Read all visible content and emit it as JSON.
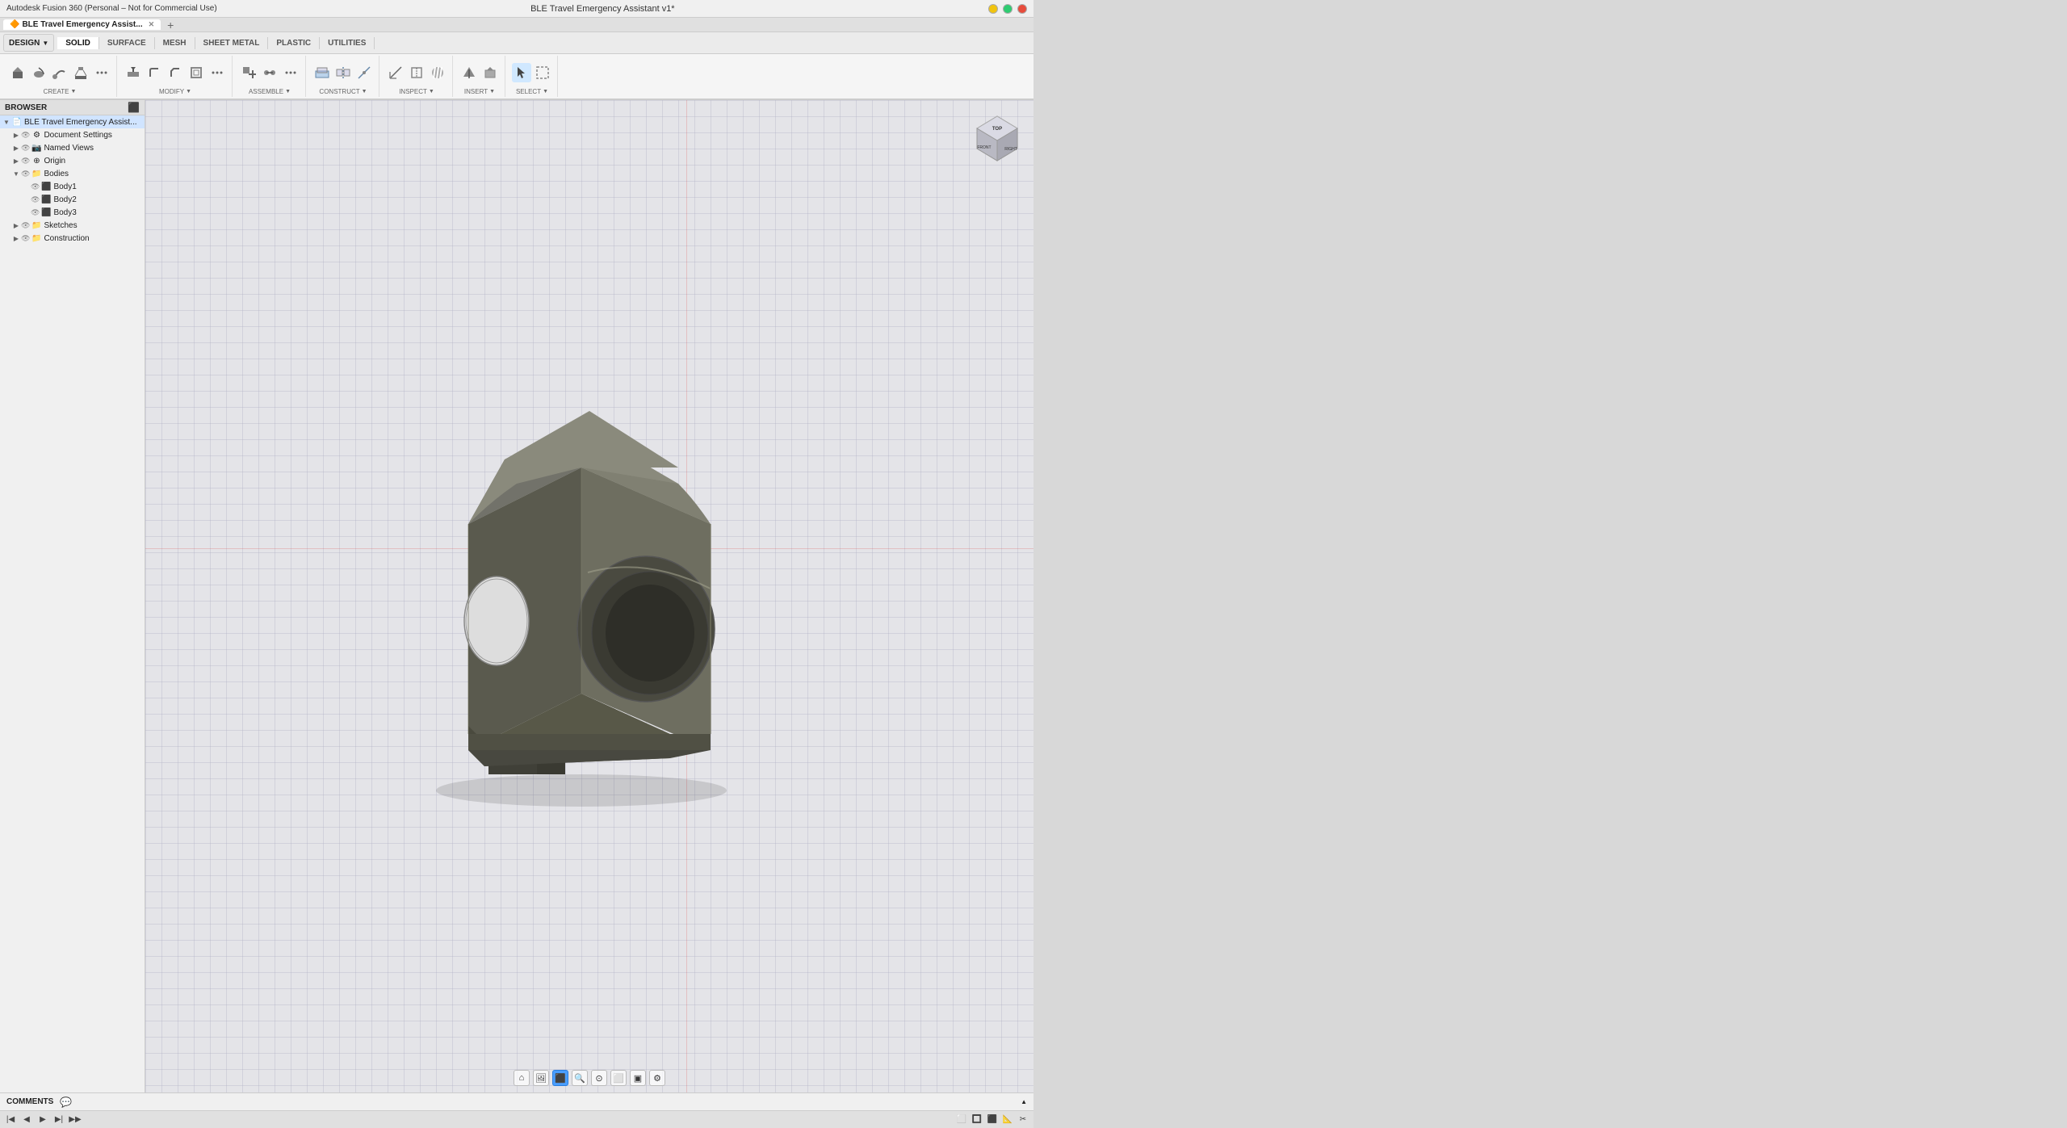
{
  "app": {
    "title": "Autodesk Fusion 360 (Personal – Not for Commercial Use)",
    "window_title": "BLE Travel Emergency Assistant v1*"
  },
  "tabs": [
    {
      "label": "BLE Travel Emergency Assist...",
      "active": true,
      "icon": "🔶"
    }
  ],
  "workspace_tabs": [
    {
      "label": "SOLID",
      "active": true
    },
    {
      "label": "SURFACE",
      "active": false
    },
    {
      "label": "MESH",
      "active": false
    },
    {
      "label": "SHEET METAL",
      "active": false
    },
    {
      "label": "PLASTIC",
      "active": false
    },
    {
      "label": "UTILITIES",
      "active": false
    }
  ],
  "toolbar": {
    "design_label": "DESIGN",
    "groups": [
      {
        "name": "create",
        "label": "CREATE",
        "icons": [
          "⬜",
          "▭",
          "◯",
          "🔷",
          "⬡",
          "🔲",
          "⚪",
          "⬛"
        ]
      },
      {
        "name": "modify",
        "label": "MODIFY",
        "icons": [
          "⊞",
          "✂",
          "⬙",
          "↕",
          "⌀",
          "🔲"
        ]
      },
      {
        "name": "assemble",
        "label": "ASSEMBLE",
        "icons": [
          "🔗",
          "⚙",
          "📐"
        ]
      },
      {
        "name": "construct",
        "label": "CONSTRUCT",
        "icons": [
          "📐",
          "⊥",
          "⊙"
        ]
      },
      {
        "name": "inspect",
        "label": "INSPECT",
        "icons": [
          "📏",
          "🔍",
          "📊"
        ]
      },
      {
        "name": "insert",
        "label": "INSERT",
        "icons": [
          "⬇",
          "📎"
        ]
      },
      {
        "name": "select",
        "label": "SELECT",
        "icons": [
          "↖",
          "▣"
        ]
      }
    ]
  },
  "browser": {
    "title": "BROWSER",
    "tree": [
      {
        "id": "root",
        "label": "BLE Travel Emergency Assist...",
        "indent": 0,
        "expanded": true,
        "type": "doc",
        "icon": "📄"
      },
      {
        "id": "doc-settings",
        "label": "Document Settings",
        "indent": 1,
        "expanded": false,
        "type": "settings",
        "icon": "⚙"
      },
      {
        "id": "named-views",
        "label": "Named Views",
        "indent": 1,
        "expanded": false,
        "type": "views",
        "icon": "📷"
      },
      {
        "id": "origin",
        "label": "Origin",
        "indent": 1,
        "expanded": false,
        "type": "origin",
        "icon": "⊕"
      },
      {
        "id": "bodies",
        "label": "Bodies",
        "indent": 1,
        "expanded": true,
        "type": "folder",
        "icon": "📁"
      },
      {
        "id": "body1",
        "label": "Body1",
        "indent": 2,
        "expanded": false,
        "type": "body",
        "icon": "⬛"
      },
      {
        "id": "body2",
        "label": "Body2",
        "indent": 2,
        "expanded": false,
        "type": "body",
        "icon": "⬛"
      },
      {
        "id": "body3",
        "label": "Body3",
        "indent": 2,
        "expanded": false,
        "type": "body",
        "icon": "⬛"
      },
      {
        "id": "sketches",
        "label": "Sketches",
        "indent": 1,
        "expanded": false,
        "type": "folder",
        "icon": "📁"
      },
      {
        "id": "construction",
        "label": "Construction",
        "indent": 1,
        "expanded": false,
        "type": "folder",
        "icon": "📁"
      }
    ]
  },
  "viewport": {
    "model_color": "#6b6b5e",
    "model_shadow": "#3a3a30",
    "grid_color": "#c8c8cc"
  },
  "viewcube": {
    "labels": [
      "TOP",
      "FRONT",
      "RIGHT"
    ]
  },
  "statusbar": {
    "tools": [
      "◀◀",
      "◀",
      "▶",
      "▶▶",
      "⬛"
    ]
  },
  "comments": {
    "label": "COMMENTS",
    "icon": "💬"
  },
  "viewport_tools": [
    {
      "icon": "⊕",
      "active": false,
      "label": "home"
    },
    {
      "icon": "🖼",
      "active": false,
      "label": "display"
    },
    {
      "icon": "⬛",
      "active": true,
      "label": "display-mode"
    },
    {
      "icon": "🔍",
      "active": false,
      "label": "zoom"
    },
    {
      "icon": "⊙",
      "active": false,
      "label": "orbit"
    },
    {
      "icon": "⬜",
      "active": false,
      "label": "view-menu"
    },
    {
      "icon": "▣",
      "active": false,
      "label": "section"
    },
    {
      "icon": "⚙",
      "active": false,
      "label": "settings"
    }
  ]
}
